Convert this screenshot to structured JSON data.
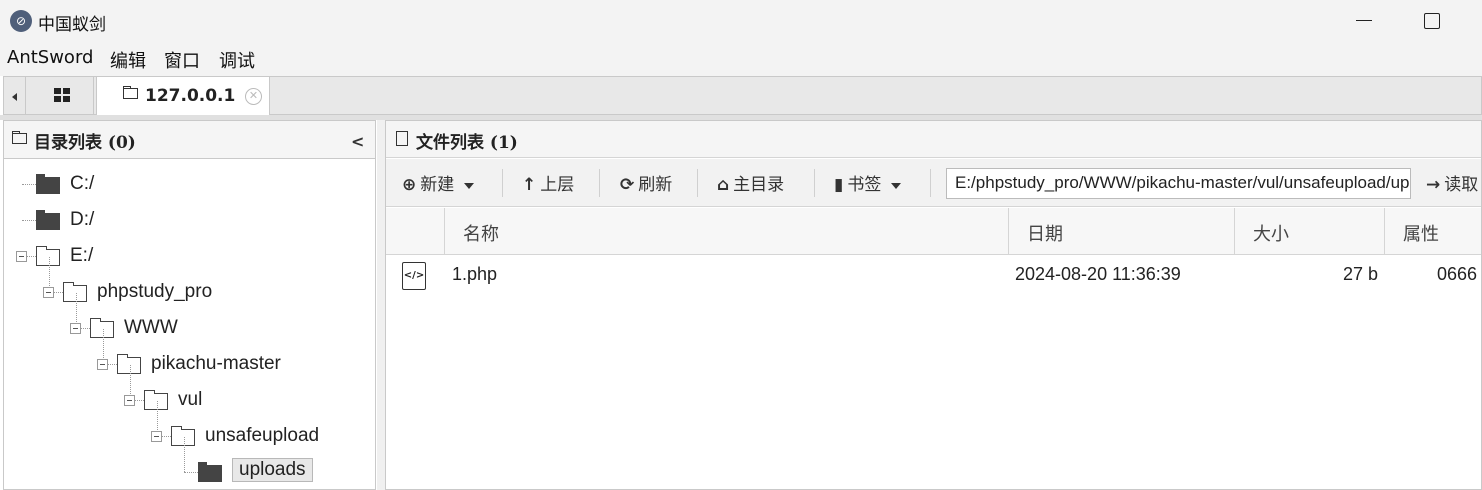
{
  "window": {
    "title": "中国蚁剑",
    "icon": "antsword-logo-icon"
  },
  "menu": {
    "items": [
      "AntSword",
      "编辑",
      "窗口",
      "调试"
    ]
  },
  "tabs": {
    "active_label": "127.0.0.1"
  },
  "left_panel": {
    "title": "目录列表 (0)",
    "tree": [
      {
        "label": "C:/",
        "level": 0,
        "expanded": false
      },
      {
        "label": "D:/",
        "level": 0,
        "expanded": false
      },
      {
        "label": "E:/",
        "level": 0,
        "expanded": true
      },
      {
        "label": "phpstudy_pro",
        "level": 1,
        "expanded": true
      },
      {
        "label": "WWW",
        "level": 2,
        "expanded": true
      },
      {
        "label": "pikachu-master",
        "level": 3,
        "expanded": true
      },
      {
        "label": "vul",
        "level": 4,
        "expanded": true
      },
      {
        "label": "unsafeupload",
        "level": 5,
        "expanded": true
      },
      {
        "label": "uploads",
        "level": 6,
        "expanded": false,
        "selected": true
      }
    ]
  },
  "right_panel": {
    "title": "文件列表 (1)",
    "toolbar": {
      "new_label": "新建",
      "up_label": "上层",
      "refresh_label": "刷新",
      "home_label": "主目录",
      "bookmark_label": "书签",
      "path_value": "E:/phpstudy_pro/WWW/pikachu-master/vul/unsafeupload/uploads/",
      "read_label": "读取"
    },
    "columns": [
      "名称",
      "日期",
      "大小",
      "属性"
    ],
    "files": [
      {
        "name": "1.php",
        "date": "2024-08-20 11:36:39",
        "size": "27 b",
        "attr": "0666",
        "icon": "php-file-icon"
      }
    ]
  }
}
